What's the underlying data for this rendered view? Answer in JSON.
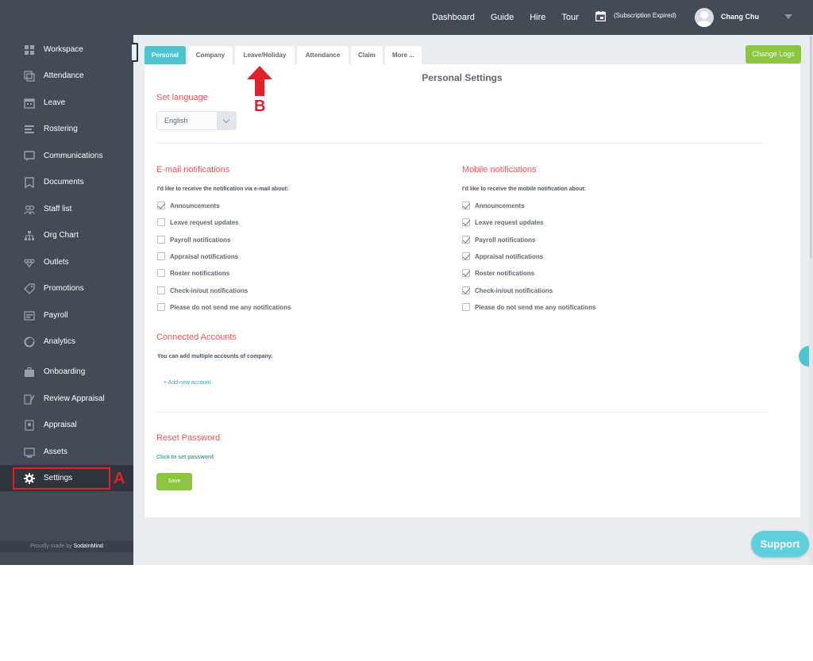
{
  "topbar": {
    "nav": [
      "Dashboard",
      "Guide",
      "Hire",
      "Tour"
    ],
    "subscription": "(Subscription Expired)",
    "user_name": "Chang Chu"
  },
  "sidebar": {
    "items": [
      {
        "label": "Workspace",
        "icon": "workspace-icon"
      },
      {
        "label": "Attendance",
        "icon": "attendance-icon"
      },
      {
        "label": "Leave",
        "icon": "calendar-icon"
      },
      {
        "label": "Rostering",
        "icon": "rostering-icon"
      },
      {
        "label": "Communications",
        "icon": "chat-icon"
      },
      {
        "label": "Documents",
        "icon": "document-icon"
      },
      {
        "label": "Staff list",
        "icon": "people-icon"
      },
      {
        "label": "Org Chart",
        "icon": "org-chart-icon"
      },
      {
        "label": "Outlets",
        "icon": "outlets-icon"
      },
      {
        "label": "Promotions",
        "icon": "tag-icon"
      },
      {
        "label": "Payroll",
        "icon": "payroll-icon"
      },
      {
        "label": "Analytics",
        "icon": "analytics-icon"
      },
      {
        "label": "Onboarding",
        "icon": "briefcase-icon"
      },
      {
        "label": "Review Appraisal",
        "icon": "review-icon"
      },
      {
        "label": "Appraisal",
        "icon": "appraisal-icon"
      },
      {
        "label": "Assets",
        "icon": "assets-icon"
      },
      {
        "label": "Settings",
        "icon": "gear-icon",
        "active": true
      }
    ],
    "footer_prefix": "Proudly made by",
    "footer_brand": "SodaInMind"
  },
  "annotations": {
    "a": "A",
    "b": "B",
    "color": "#e2202a"
  },
  "tabs": [
    "Personal",
    "Company",
    "Leave/Holiday",
    "Attendance",
    "Claim",
    "More ..."
  ],
  "change_logs": "Change Logs",
  "settings": {
    "title": "Personal Settings",
    "language_title": "Set language",
    "language_value": "English",
    "email": {
      "title": "E-mail notifications",
      "intro": "I'd like to receive the notification via e-mail about:",
      "options": [
        {
          "label": "Announcements",
          "checked": true
        },
        {
          "label": "Leave request updates",
          "checked": false
        },
        {
          "label": "Payroll notifications",
          "checked": false
        },
        {
          "label": "Appraisal notifications",
          "checked": false
        },
        {
          "label": "Roster notifications",
          "checked": false
        },
        {
          "label": "Check-in/out notifications",
          "checked": false
        },
        {
          "label": "Please do not send me any notifications",
          "checked": false
        }
      ]
    },
    "mobile": {
      "title": "Mobile notifications",
      "intro": "I'd like to receive the mobile notification about:",
      "options": [
        {
          "label": "Announcements",
          "checked": true
        },
        {
          "label": "Leave request updates",
          "checked": true
        },
        {
          "label": "Payroll notifications",
          "checked": true
        },
        {
          "label": "Appraisal notifications",
          "checked": true
        },
        {
          "label": "Roster notifications",
          "checked": true
        },
        {
          "label": "Check-in/out notifications",
          "checked": true
        },
        {
          "label": "Please do not send me any notifications",
          "checked": false
        }
      ]
    },
    "connected": {
      "title": "Connected Accounts",
      "intro": "You can add multiple accounts of company.",
      "add_link": "+ Add new account"
    },
    "reset": {
      "title": "Reset Password",
      "link": "Click to set password"
    },
    "save_label": "Save"
  },
  "support_label": "Support",
  "colors": {
    "accent": "#4fc3ce",
    "green": "#8cc63f",
    "sidebar": "#434b56",
    "section_title": "#e05a5f"
  }
}
